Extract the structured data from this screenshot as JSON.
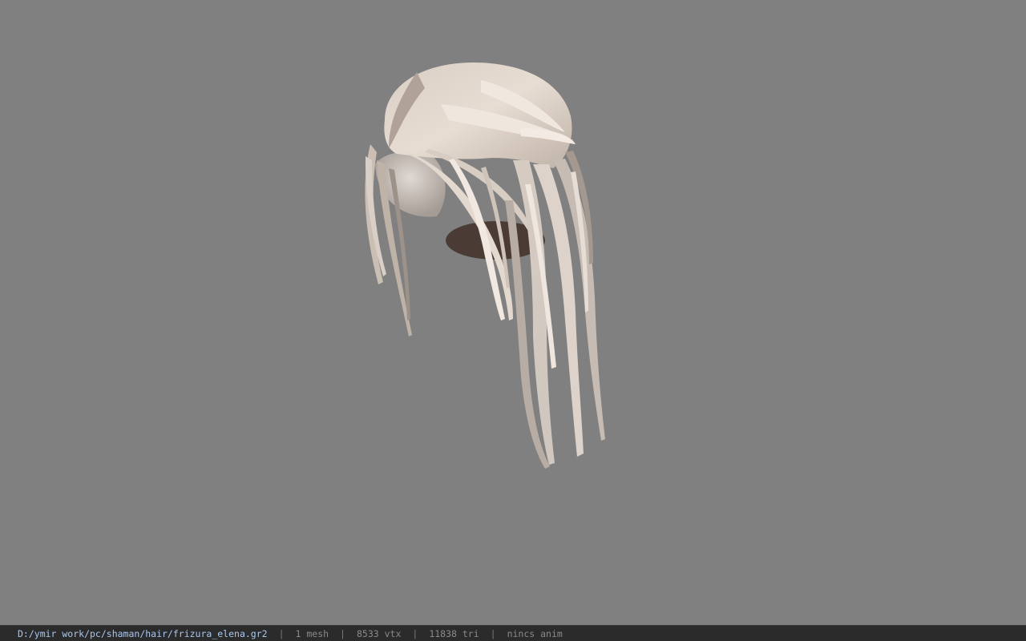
{
  "viewer": {
    "background_color": "#808080",
    "model_icon": "hair-model-icon"
  },
  "status": {
    "file_path": "D:/ymir work/pc/shaman/hair/frizura_elena.gr2",
    "separator": "|",
    "mesh": "1 mesh",
    "vertices": "8533 vtx",
    "triangles": "11838 tri",
    "anim": "nincs anim"
  },
  "colors": {
    "statusbar_bg": "#2b2b2b",
    "path_text": "#a8c8f0",
    "info_text": "#8a8a8a",
    "hair_light": "#e2d8cf",
    "hair_mid": "#c9bcb1",
    "hair_dark": "#9a8f86",
    "scalp": "#4a3c34"
  }
}
